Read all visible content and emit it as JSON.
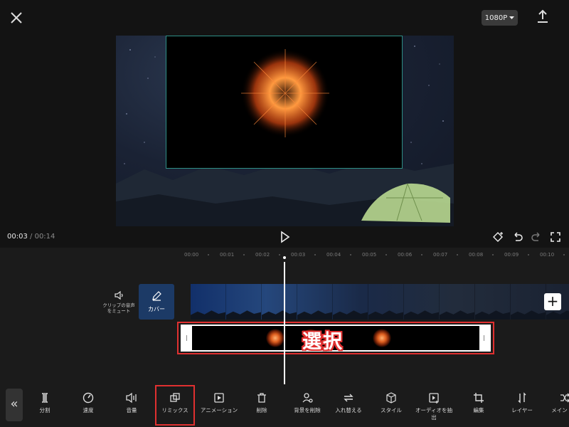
{
  "topbar": {
    "resolution": "1080P"
  },
  "playback": {
    "current_time": "00:03",
    "separator": "/",
    "total_time": "00:14"
  },
  "timeline": {
    "ticks": [
      "00:00",
      "00:01",
      "00:02",
      "00:03",
      "00:04",
      "00:05",
      "00:06",
      "00:07",
      "00:08",
      "00:09",
      "00:10"
    ],
    "mute_label": "クリップの音声をミュート",
    "cover_label": "カバー",
    "add_label": "+",
    "selection_annotation": "選択"
  },
  "toolbar": {
    "collapse_label": "«",
    "items": [
      {
        "label": "分割",
        "icon": "split-icon"
      },
      {
        "label": "速度",
        "icon": "speed-icon"
      },
      {
        "label": "音量",
        "icon": "volume-icon"
      },
      {
        "label": "リミックス",
        "icon": "remix-icon"
      },
      {
        "label": "アニメーション",
        "icon": "animation-icon"
      },
      {
        "label": "削除",
        "icon": "trash-icon"
      },
      {
        "label": "背景を削除",
        "icon": "remove-background-icon"
      },
      {
        "label": "入れ替える",
        "icon": "replace-icon"
      },
      {
        "label": "スタイル",
        "icon": "style-icon"
      },
      {
        "label": "オーディオを抽出",
        "icon": "extract-audio-icon"
      },
      {
        "label": "編集",
        "icon": "crop-icon"
      },
      {
        "label": "レイヤー",
        "icon": "layer-icon"
      },
      {
        "label": "メイントラ",
        "icon": "main-track-icon"
      }
    ]
  },
  "colors": {
    "highlight": "#e03030",
    "clip_border": "#2e8f86",
    "accent_cover": "#1c3a66"
  }
}
